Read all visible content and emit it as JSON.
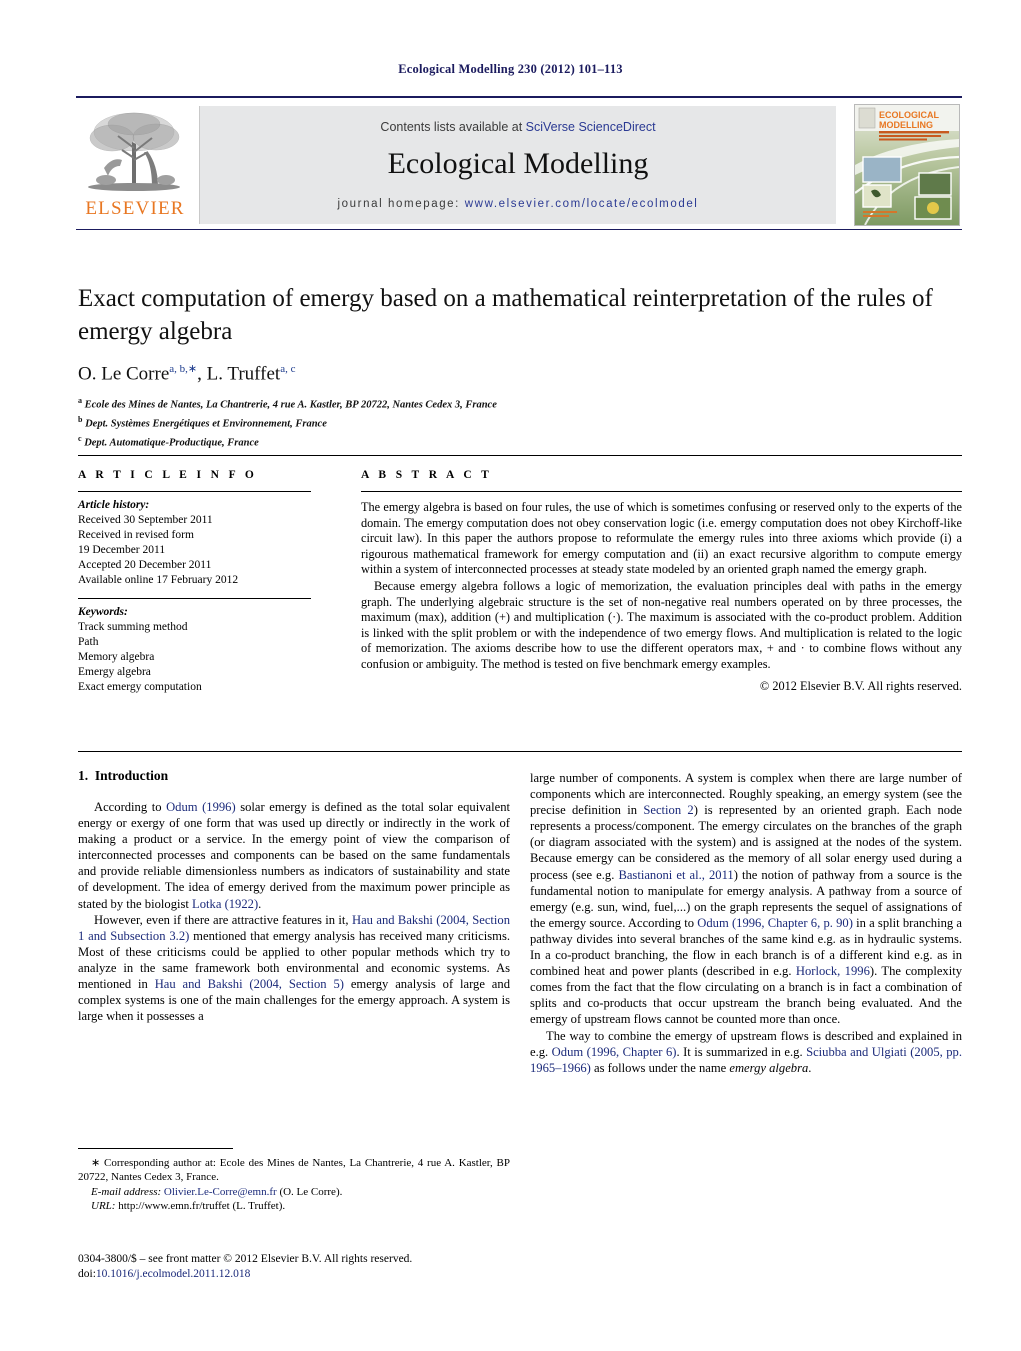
{
  "running_head": "Ecological Modelling 230 (2012) 101–113",
  "masthead": {
    "contents_prefix": "Contents lists available at ",
    "contents_link": "SciVerse ScienceDirect",
    "journal_name": "Ecological Modelling",
    "homepage_prefix": "journal homepage: ",
    "homepage_url": "www.elsevier.com/locate/ecolmodel",
    "publisher_logo_text": "ELSEVIER",
    "cover_title_line1": "ECOLOGICAL",
    "cover_title_line2": "MODELLING",
    "cover_subtitle": "AN INTERNATIONAL JOURNAL ON ECOLOGICAL MODELLING AND SYSTEMS ECOLOGY",
    "accent_orange": "#e87722",
    "accent_navy": "#1b1b5e",
    "band_gray": "#e6e7e8"
  },
  "title": "Exact computation of emergy based on a mathematical reinterpretation of the rules of emergy algebra",
  "authors": {
    "author1_name": "O. Le Corre",
    "author1_sup": "a, b,∗",
    "separator": ", ",
    "author2_name": "L. Truffet",
    "author2_sup": "a, c"
  },
  "affiliations": [
    {
      "marker": "a",
      "text": "Ecole des Mines de Nantes, La Chantrerie, 4 rue A. Kastler, BP 20722, Nantes Cedex 3, France"
    },
    {
      "marker": "b",
      "text": "Dept. Systèmes Energétiques et Environnement, France"
    },
    {
      "marker": "c",
      "text": "Dept. Automatique-Productique, France"
    }
  ],
  "article_info": {
    "heading": "A R T I C L E   I N F O",
    "history_label": "Article history:",
    "history": [
      "Received 30 September 2011",
      "Received in revised form",
      "19 December 2011",
      "Accepted 20 December 2011",
      "Available online 17 February 2012"
    ],
    "keywords_label": "Keywords:",
    "keywords": [
      "Track summing method",
      "Path",
      "Memory algebra",
      "Emergy algebra",
      "Exact emergy computation"
    ]
  },
  "abstract": {
    "heading": "A B S T R A C T",
    "paragraph1": "The emergy algebra is based on four rules, the use of which is sometimes confusing or reserved only to the experts of the domain. The emergy computation does not obey conservation logic (i.e. emergy computation does not obey Kirchoff-like circuit law). In this paper the authors propose to reformulate the emergy rules into three axioms which provide (i) a rigourous mathematical framework for emergy computation and (ii) an exact recursive algorithm to compute emergy within a system of interconnected processes at steady state modeled by an oriented graph named the emergy graph.",
    "paragraph2": "Because emergy algebra follows a logic of memorization, the evaluation principles deal with paths in the emergy graph. The underlying algebraic structure is the set of non-negative real numbers operated on by three processes, the maximum (max), addition (+) and multiplication (·). The maximum is associated with the co-product problem. Addition is linked with the split problem or with the independence of two emergy flows. And multiplication is related to the logic of memorization. The axioms describe how to use the different operators max, + and · to combine flows without any confusion or ambiguity. The method is tested on five benchmark emergy examples.",
    "copyright": "© 2012 Elsevier B.V. All rights reserved."
  },
  "introduction": {
    "section_number": "1.",
    "section_title": "Introduction",
    "left_para1_a": "According to ",
    "left_para1_link1": "Odum (1996)",
    "left_para1_b": " solar emergy is defined as the total solar equivalent energy or exergy of one form that was used up directly or indirectly in the work of making a product or a service. In the emergy point of view the comparison of interconnected processes and components can be based on the same fundamentals and provide reliable dimensionless numbers as indicators of sustainability and state of development. The idea of emergy derived from the maximum power principle as stated by the biologist ",
    "left_para1_link2": "Lotka (1922)",
    "left_para1_c": ".",
    "left_para2_a": "However, even if there are attractive features in it, ",
    "left_para2_link1": "Hau and Bakshi (2004, Section 1 and Subsection 3.2)",
    "left_para2_b": " mentioned that emergy analysis has received many criticisms. Most of these criticisms could be applied to other popular methods which try to analyze in the same framework both environmental and economic systems. As mentioned in ",
    "left_para2_link2": "Hau and Bakshi (2004, Section 5)",
    "left_para2_c": " emergy analysis of large and complex systems is one of the main challenges for the emergy approach. A system is large when it possesses a",
    "right_para1_a": "large number of components. A system is complex when there are large number of components which are interconnected. Roughly speaking, an emergy system (see the precise definition in ",
    "right_para1_link1": "Section 2",
    "right_para1_b": ") is represented by an oriented graph. Each node represents a process/component. The emergy circulates on the branches of the graph (or diagram associated with the system) and is assigned at the nodes of the system. Because emergy can be considered as the memory of all solar energy used during a process (see e.g. ",
    "right_para1_link2": "Bastianoni et al., 2011",
    "right_para1_c": ") the notion of pathway from a source is the fundamental notion to manipulate for emergy analysis. A pathway from a source of emergy (e.g. sun, wind, fuel,...) on the graph represents the sequel of assignations of the emergy source. According to ",
    "right_para1_link3": "Odum (1996, Chapter 6, p. 90)",
    "right_para1_d": " in a split branching a pathway divides into several branches of the same kind e.g. as in hydraulic systems. In a co-product branching, the flow in each branch is of a different kind e.g. as in combined heat and power plants (described in e.g. ",
    "right_para1_link4": "Horlock, 1996",
    "right_para1_e": "). The complexity comes from the fact that the flow circulating on a branch is in fact a combination of splits and co-products that occur upstream the branch being evaluated. And the emergy of upstream flows cannot be counted more than once.",
    "right_para2_a": "The way to combine the emergy of upstream flows is described and explained in e.g. ",
    "right_para2_link1": "Odum (1996, Chapter 6)",
    "right_para2_b": ". It is summarized in e.g. ",
    "right_para2_link2": "Sciubba and Ulgiati (2005, pp. 1965–1966)",
    "right_para2_c": " as follows under the name ",
    "right_para2_italic": "emergy algebra",
    "right_para2_d": "."
  },
  "footnotes": {
    "corresponding": "∗ Corresponding author at: Ecole des Mines de Nantes, La Chantrerie, 4 rue A. Kastler, BP 20722, Nantes Cedex 3, France.",
    "email_label": "E-mail address:",
    "email_value": "Olivier.Le-Corre@emn.fr",
    "email_owner": " (O. Le Corre).",
    "url_label": "URL:",
    "url_value": " http://www.emn.fr/truffet",
    "url_owner": " (L. Truffet).",
    "imprint_line1": "0304-3800/$ – see front matter © 2012 Elsevier B.V. All rights reserved.",
    "imprint_doi_label": "doi:",
    "imprint_doi_value": "10.1016/j.ecolmodel.2011.12.018"
  }
}
